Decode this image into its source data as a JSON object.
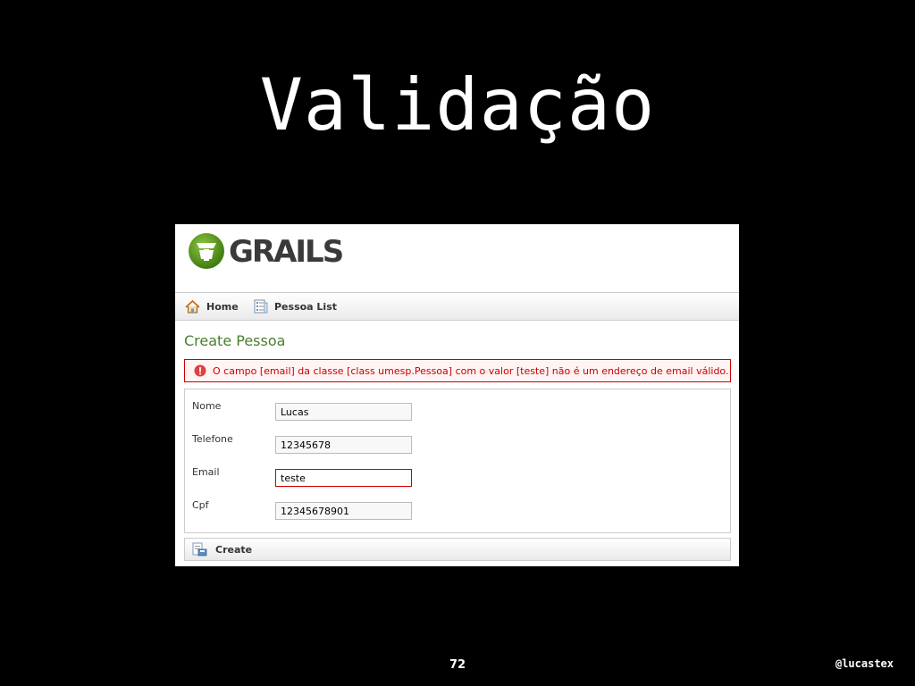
{
  "slide": {
    "title": "Validação",
    "page_number": "72",
    "handle": "@lucastex"
  },
  "app": {
    "logo_text": "GRAILS",
    "nav": {
      "home_label": "Home",
      "list_label": "Pessoa List"
    },
    "heading": "Create Pessoa",
    "error_message": "O campo [email] da classe [class umesp.Pessoa] com o valor [teste] não é um endereço de email válido.",
    "form": {
      "fields": [
        {
          "label": "Nome",
          "value": "Lucas"
        },
        {
          "label": "Telefone",
          "value": "12345678"
        },
        {
          "label": "Email",
          "value": "teste"
        },
        {
          "label": "Cpf",
          "value": "12345678901"
        }
      ]
    },
    "create_label": "Create"
  },
  "colors": {
    "heading": "#48802c",
    "error": "#cc0000",
    "logo_green": "#5a9a1f"
  },
  "icons": {
    "logo": "grails-logo-icon",
    "home": "home-icon",
    "list": "list-icon",
    "error": "error-icon",
    "create": "create-icon"
  }
}
